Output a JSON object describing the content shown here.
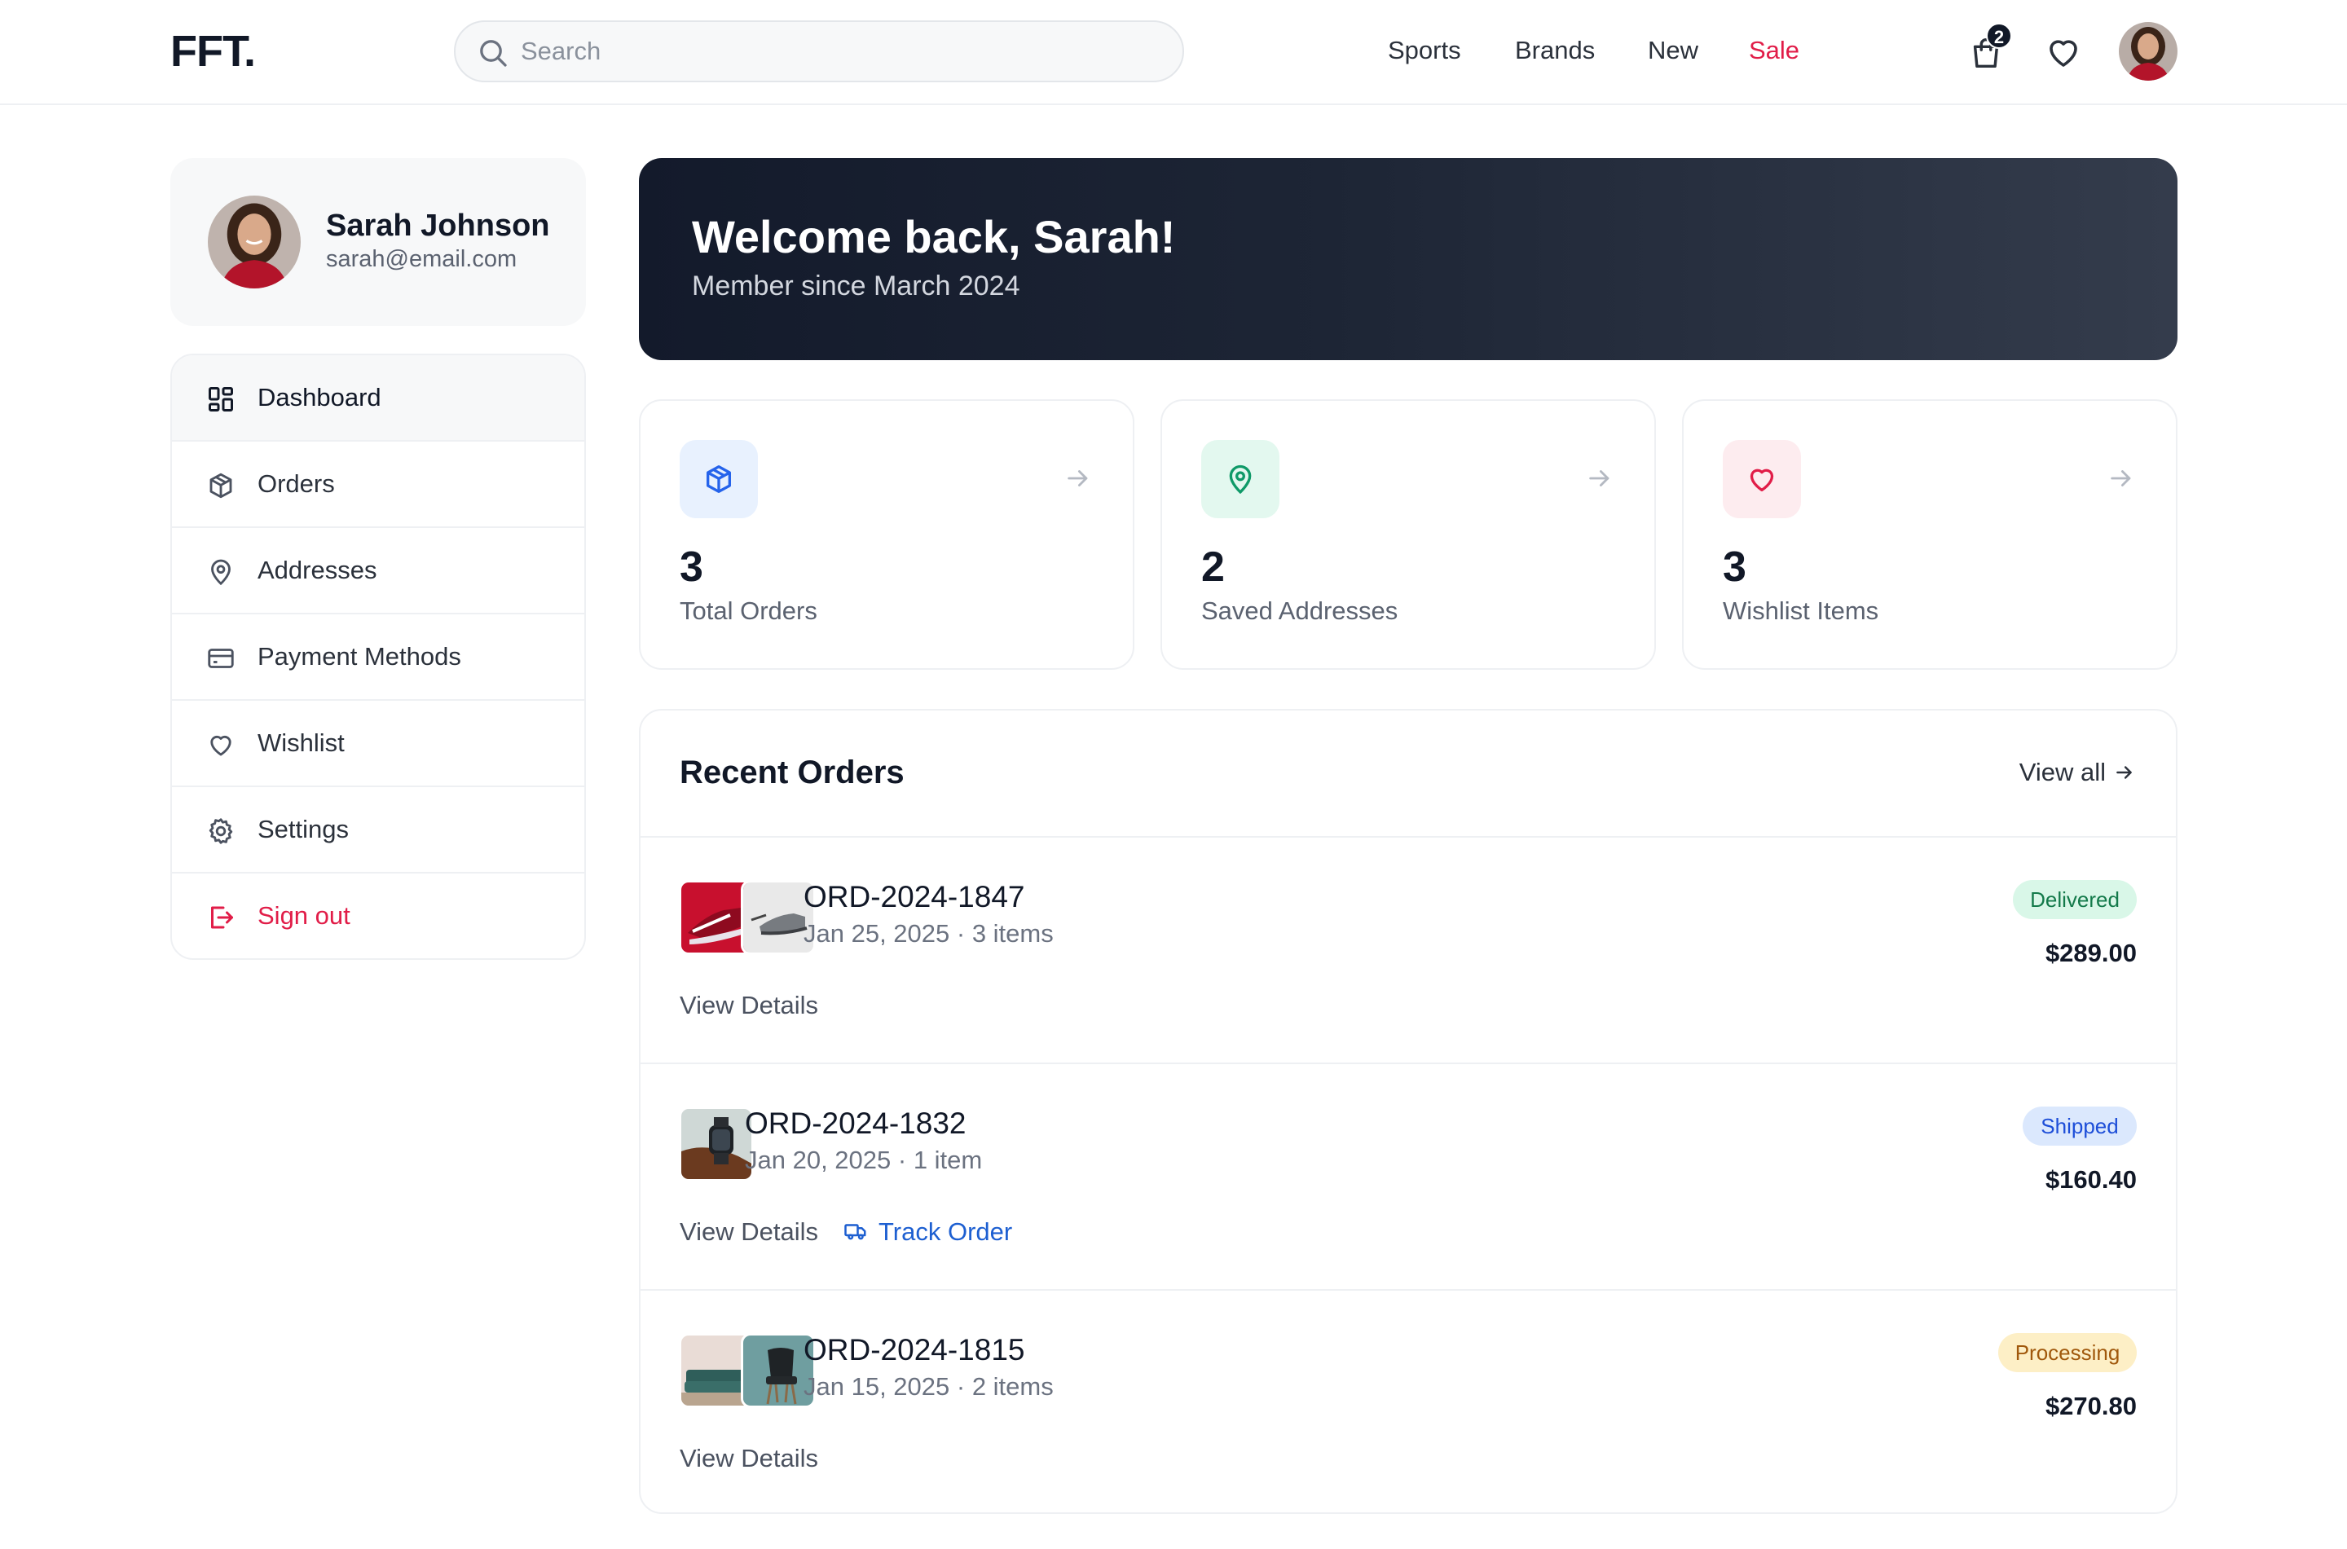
{
  "header": {
    "logo": "FFT.",
    "search_placeholder": "Search",
    "nav": [
      "Sports",
      "Brands",
      "New",
      "Sale"
    ],
    "cart_count": "2"
  },
  "profile": {
    "name": "Sarah Johnson",
    "email": "sarah@email.com"
  },
  "sidebar": {
    "items": [
      {
        "label": "Dashboard",
        "icon": "dashboard-icon"
      },
      {
        "label": "Orders",
        "icon": "box-icon"
      },
      {
        "label": "Addresses",
        "icon": "map-pin-icon"
      },
      {
        "label": "Payment Methods",
        "icon": "credit-card-icon"
      },
      {
        "label": "Wishlist",
        "icon": "heart-icon"
      },
      {
        "label": "Settings",
        "icon": "gear-icon"
      },
      {
        "label": "Sign out",
        "icon": "sign-out-icon"
      }
    ]
  },
  "welcome": {
    "title": "Welcome back, Sarah!",
    "subtitle": "Member since March 2024"
  },
  "stats": [
    {
      "value": "3",
      "label": "Total Orders",
      "icon": "box-icon",
      "color": "#2563eb",
      "bg": "#e8f1fe"
    },
    {
      "value": "2",
      "label": "Saved Addresses",
      "icon": "map-pin-icon",
      "color": "#0f9a68",
      "bg": "#e3f8ef"
    },
    {
      "value": "3",
      "label": "Wishlist Items",
      "icon": "heart-icon",
      "color": "#e11d48",
      "bg": "#fdecef"
    }
  ],
  "orders": {
    "title": "Recent Orders",
    "view_all": "View all",
    "rows": [
      {
        "id": "ORD-2024-1847",
        "meta": "Jan 25, 2025 · 3 items",
        "status": "Delivered",
        "total": "$289.00",
        "actions": [
          "View Details"
        ]
      },
      {
        "id": "ORD-2024-1832",
        "meta": "Jan 20, 2025 · 1 item",
        "status": "Shipped",
        "total": "$160.40",
        "actions": [
          "View Details",
          "Track Order"
        ]
      },
      {
        "id": "ORD-2024-1815",
        "meta": "Jan 15, 2025 · 2 items",
        "status": "Processing",
        "total": "$270.80",
        "actions": [
          "View Details"
        ]
      }
    ]
  },
  "colors": {
    "accent_red": "#e11d48",
    "banner_dark": "#131a2b",
    "link_blue": "#1d5fd1"
  }
}
